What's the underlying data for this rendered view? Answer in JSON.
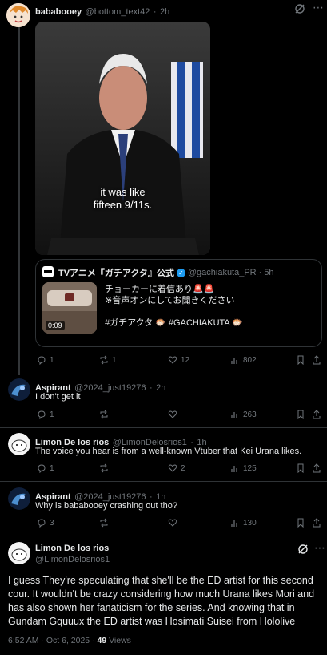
{
  "tweets": [
    {
      "name": "bababooey",
      "handle": "@bottom_text42",
      "time": "2h",
      "video_caption_1": "it was like",
      "video_caption_2": "fifteen 9/11s.",
      "quote": {
        "name": "TVアニメ『ガチアクタ』公式",
        "handle": "@gachiakuta_PR",
        "time": "5h",
        "line1": "チョーカーに着信あり🚨🚨",
        "line2": "※音声オンにしてお聞きください",
        "hashtags": "#ガチアクタ 🐡 #GACHIAKUTA 🐡",
        "duration": "0:09"
      },
      "replies": "1",
      "reposts": "1",
      "likes": "12",
      "views": "802"
    },
    {
      "name": "Aspirant",
      "handle": "@2024_just19276",
      "time": "2h",
      "text": "I don't get it",
      "replies": "1",
      "reposts": "",
      "likes": "",
      "views": "263"
    },
    {
      "name": "Limon De los rios",
      "handle": "@LimonDelosrios1",
      "time": "1h",
      "text": "The voice you hear is from a well-known Vtuber that Kei Urana likes.",
      "replies": "1",
      "reposts": "",
      "likes": "2",
      "views": "125"
    },
    {
      "name": "Aspirant",
      "handle": "@2024_just19276",
      "time": "1h",
      "text": "Why is bababooey crashing out tho?",
      "replies": "3",
      "reposts": "",
      "likes": "",
      "views": "130"
    }
  ],
  "main": {
    "name": "Limon De los rios",
    "handle": "@LimonDelosrios1",
    "text": "I guess They're speculating that she'll be the ED artist for this second cour. It wouldn't be crazy considering how much Urana likes Mori and has also shown her fanaticism for the series. And knowing that in Gundam Gquuux the ED artist was Hosimati Suisei from Hololive",
    "timestamp": "6:52 AM · Oct 6, 2025 · ",
    "views_count": "49",
    "views_label": " Views"
  },
  "icons": [
    "grok-icon",
    "more-icon",
    "reply-icon",
    "repost-icon",
    "like-icon",
    "views-icon",
    "bookmark-icon",
    "share-icon",
    "verified-icon"
  ],
  "colors": {
    "background": "#000000",
    "text": "#e7e9ea",
    "muted": "#71767b",
    "verified": "#1d9bf0",
    "divider": "#2f3336"
  }
}
